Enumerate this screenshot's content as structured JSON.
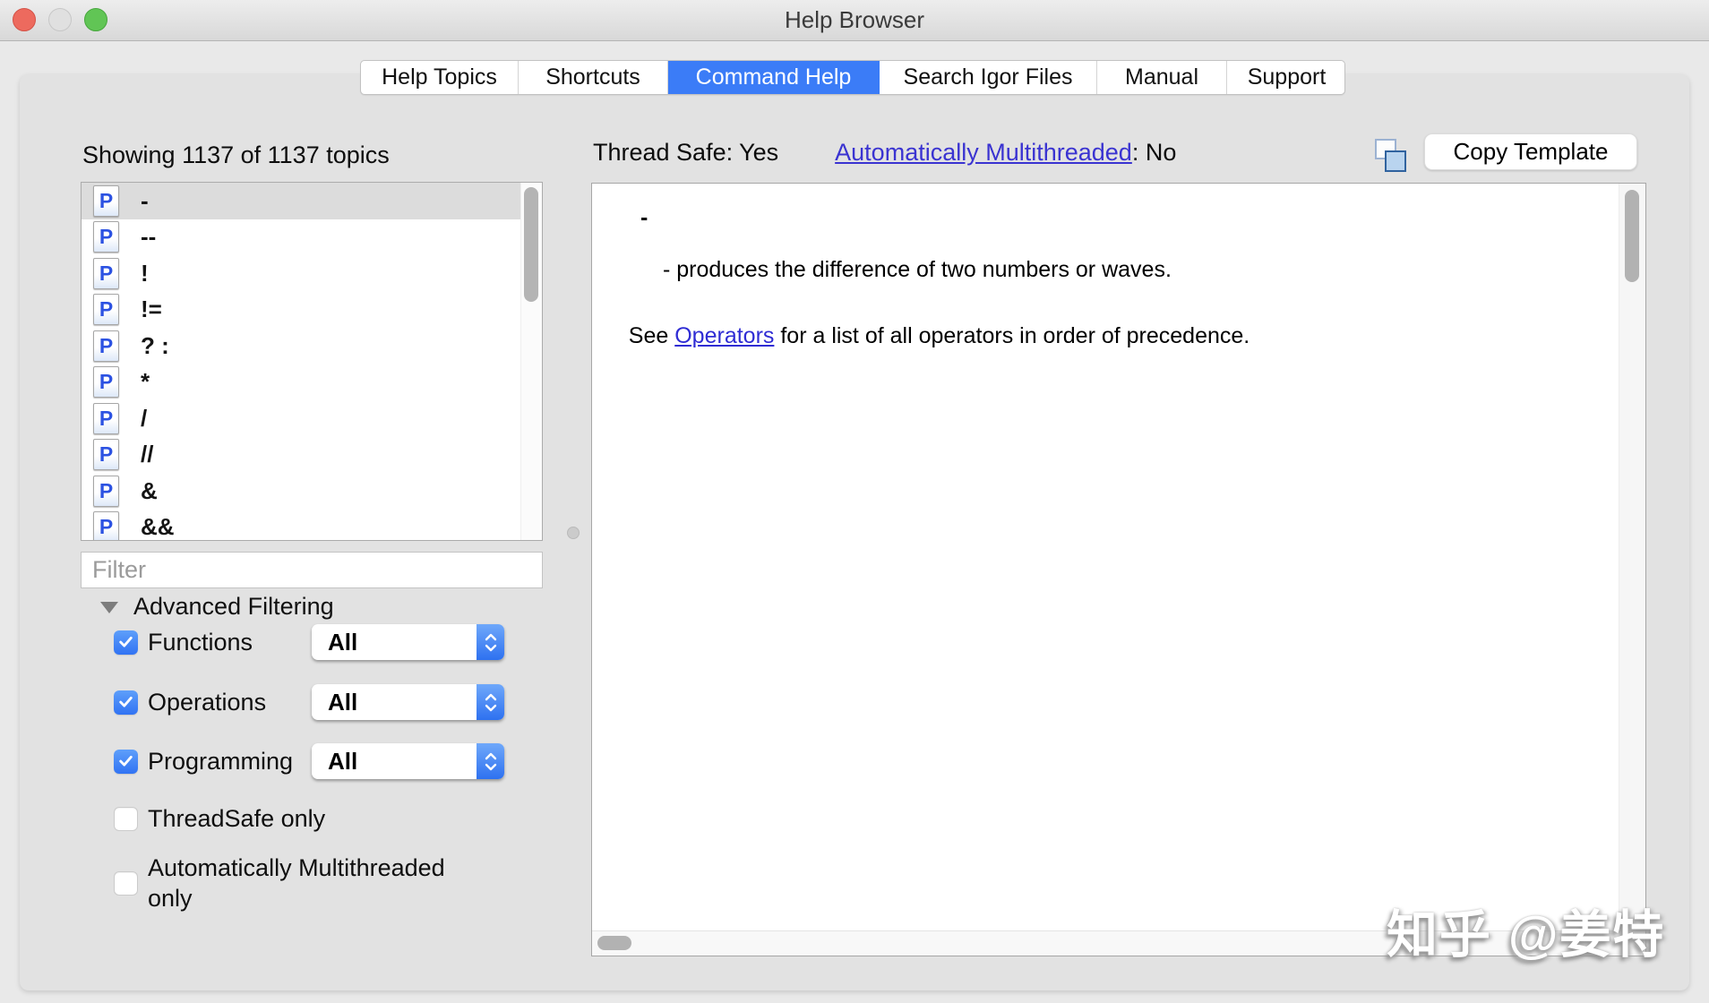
{
  "window": {
    "title": "Help Browser"
  },
  "tabs": [
    {
      "label": "Help Topics",
      "selected": false
    },
    {
      "label": "Shortcuts",
      "selected": false
    },
    {
      "label": "Command Help",
      "selected": true
    },
    {
      "label": "Search Igor Files",
      "selected": false
    },
    {
      "label": "Manual",
      "selected": false
    },
    {
      "label": "Support",
      "selected": false
    }
  ],
  "topics_panel": {
    "header": "Showing 1137 of 1137 topics",
    "icon_glyph": "P",
    "items": [
      {
        "label": "-",
        "selected": true
      },
      {
        "label": "--",
        "selected": false
      },
      {
        "label": "!",
        "selected": false
      },
      {
        "label": "!=",
        "selected": false
      },
      {
        "label": "? :",
        "selected": false
      },
      {
        "label": "*",
        "selected": false
      },
      {
        "label": "/",
        "selected": false
      },
      {
        "label": "//",
        "selected": false
      },
      {
        "label": "&",
        "selected": false
      },
      {
        "label": "&&",
        "selected": false
      }
    ],
    "filter_placeholder": "Filter",
    "filter_value": "",
    "advanced": {
      "title": "Advanced Filtering",
      "rows": [
        {
          "label": "Functions",
          "checked": true,
          "dropdown_value": "All"
        },
        {
          "label": "Operations",
          "checked": true,
          "dropdown_value": "All"
        },
        {
          "label": "Programming",
          "checked": true,
          "dropdown_value": "All"
        },
        {
          "label": "ThreadSafe only",
          "checked": false
        },
        {
          "label": "Automatically Multithreaded only",
          "checked": false
        }
      ]
    }
  },
  "help_panel": {
    "thread_safe_label": "Thread Safe: Yes",
    "multithreaded_link": "Automatically Multithreaded",
    "multithreaded_value": ": No",
    "copy_template_label": "Copy Template",
    "content": {
      "line1": "-",
      "line2": "- produces the difference of two numbers or waves.",
      "line3_pre": "See ",
      "line3_link": "Operators",
      "line3_post": " for a list of all operators in order of precedence."
    }
  },
  "watermark": "知乎 @姜特",
  "colors": {
    "tab_selected_blue": "#3b7cf7",
    "checkbox_blue": "#3d80f7",
    "link_blue": "#3a33d1",
    "content_link_blue": "#2f2cd4",
    "selected_row_gray": "#dcdcdc",
    "panel_gray": "#e2e2e2"
  }
}
